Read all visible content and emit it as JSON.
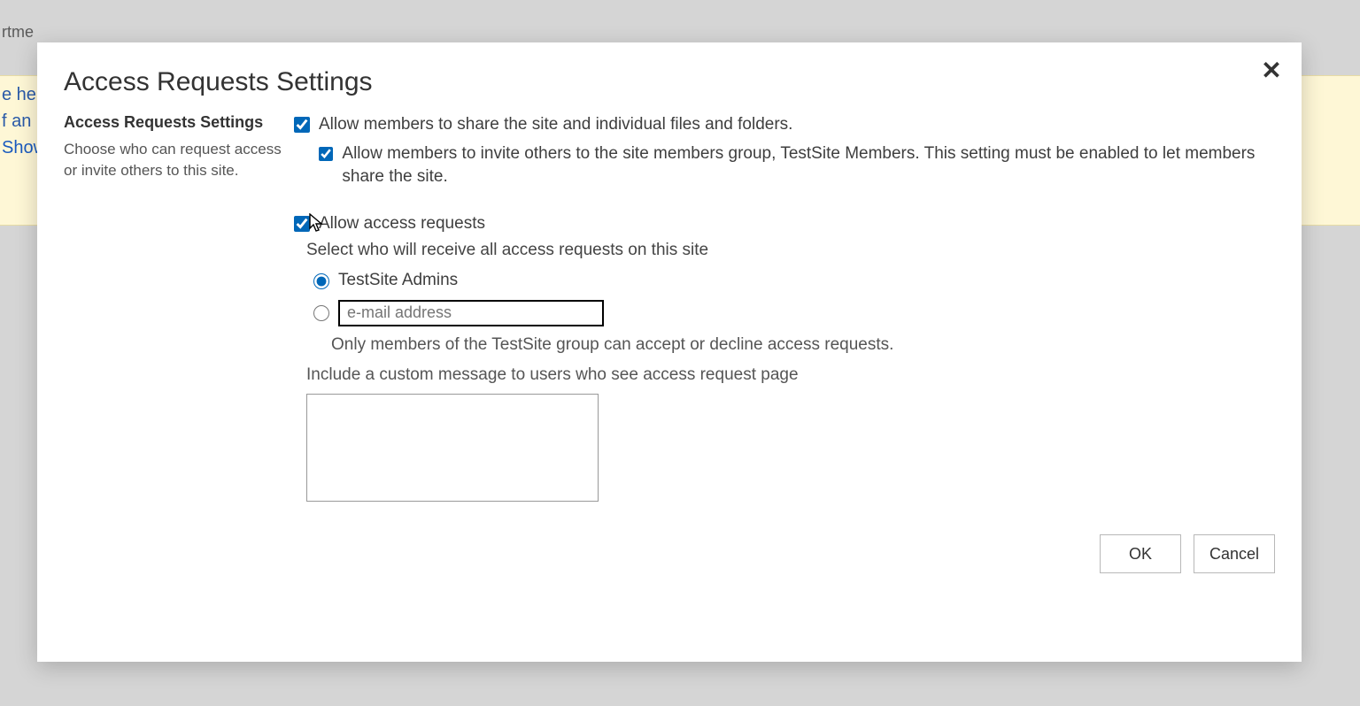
{
  "background": {
    "breadcrumb_fragment": "rtme",
    "line1": "e her",
    "line2": "f an it",
    "line3_link": "Show"
  },
  "dialog": {
    "title": "Access Requests Settings",
    "close_glyph": "✕",
    "side": {
      "heading": "Access Requests Settings",
      "description": "Choose who can request access or invite others to this site."
    },
    "options": {
      "allow_share_label": "Allow members to share the site and individual files and folders.",
      "allow_share_checked": true,
      "allow_invite_label": "Allow members to invite others to the site members group, TestSite Members. This setting must be enabled to let members share the site.",
      "allow_invite_checked": true,
      "allow_requests_label": "Allow access requests",
      "allow_requests_checked": true,
      "recipients_label": "Select who will receive all access requests on this site",
      "radio_admins_label": "TestSite Admins",
      "radio_selected": "admins",
      "email_placeholder": "e-mail address",
      "email_value": "",
      "note": "Only members of the TestSite group can accept or decline access requests.",
      "custom_msg_label": "Include a custom message to users who see access request page",
      "custom_msg_value": ""
    },
    "buttons": {
      "ok": "OK",
      "cancel": "Cancel"
    }
  }
}
